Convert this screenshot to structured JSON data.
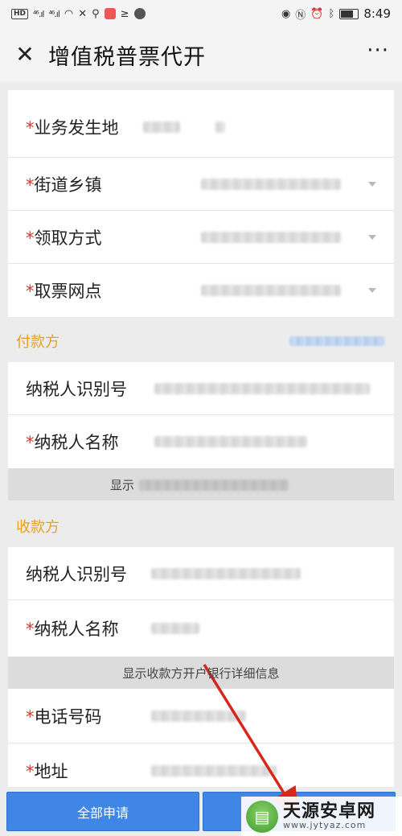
{
  "status_bar": {
    "hd": "HD",
    "signal1": "⁴⁶.ıl",
    "signal2": "⁴⁶.ıl",
    "time": "8:49"
  },
  "header": {
    "close_icon": "close-icon",
    "title": "增值税普票代开",
    "more_icon": "more-icon"
  },
  "top_card": {
    "rows": [
      {
        "label": "业务发生地",
        "required": true
      },
      {
        "label": "街道乡镇",
        "required": true
      },
      {
        "label": "领取方式",
        "required": true
      },
      {
        "label": "取票网点",
        "required": true
      }
    ]
  },
  "payer": {
    "title": "付款方",
    "rows": [
      {
        "label": "纳税人识别号",
        "required": false
      },
      {
        "label": "纳税人名称",
        "required": true
      }
    ],
    "expand_text": "显示"
  },
  "payee": {
    "title": "收款方",
    "rows": [
      {
        "label": "纳税人识别号",
        "required": false
      },
      {
        "label": "纳税人名称",
        "required": true
      }
    ],
    "expand_text": "显示收款方开户银行详细信息",
    "more_rows": [
      {
        "label": "电话号码",
        "required": true
      },
      {
        "label": "地址",
        "required": true
      }
    ]
  },
  "required_mark": "*",
  "bottom": {
    "apply_all": "全部申请"
  },
  "watermark": {
    "name": "天源安卓网",
    "url": "www.jytyaz.com"
  },
  "colors": {
    "accent_blue": "#3f86e6",
    "section_orange": "#e9a11e",
    "required_red": "#e0302a",
    "arrow_red": "#d9261c"
  }
}
